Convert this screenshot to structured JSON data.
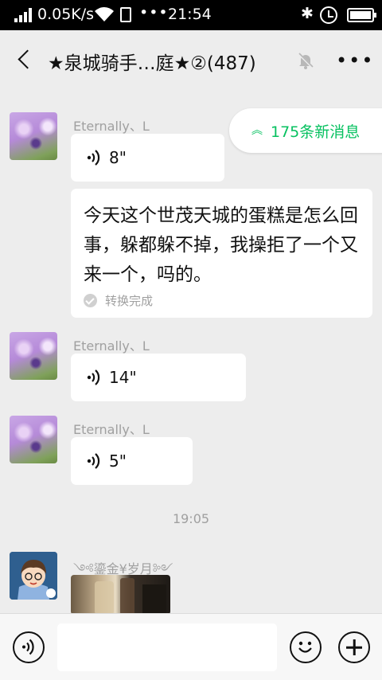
{
  "status_bar": {
    "network_speed": "0.05K/s",
    "more_dots": "•••",
    "time": "21:54",
    "bluetooth_glyph": "✱"
  },
  "header": {
    "title": "★泉城骑手…庭★②(487)",
    "back_icon": "chevron-left-icon",
    "mute_icon": "bell-off-icon",
    "more_label": "•••"
  },
  "new_messages": {
    "arrow": "︽",
    "label": "175条新消息"
  },
  "messages": [
    {
      "sender": "Eternally、L",
      "voice_duration": "8\"",
      "transcript": "今天这个世茂天城的蛋糕是怎么回事，躲都躲不掉，我操拒了一个又来一个，吗的。",
      "transcript_status": "转换完成"
    },
    {
      "sender": "Eternally、L",
      "voice_duration": "14\""
    },
    {
      "sender": "Eternally、L",
      "voice_duration": "5\""
    }
  ],
  "timestamp": "19:05",
  "last_message": {
    "sender": "༺鎏金¥岁月༻",
    "type": "image"
  },
  "input_bar": {
    "voice_icon": "voice-input-icon",
    "emoji_icon": "emoji-icon",
    "plus_icon": "add-icon",
    "text_value": ""
  },
  "colors": {
    "accent_green": "#07c160",
    "chat_background": "#ededed",
    "bubble": "#ffffff"
  }
}
